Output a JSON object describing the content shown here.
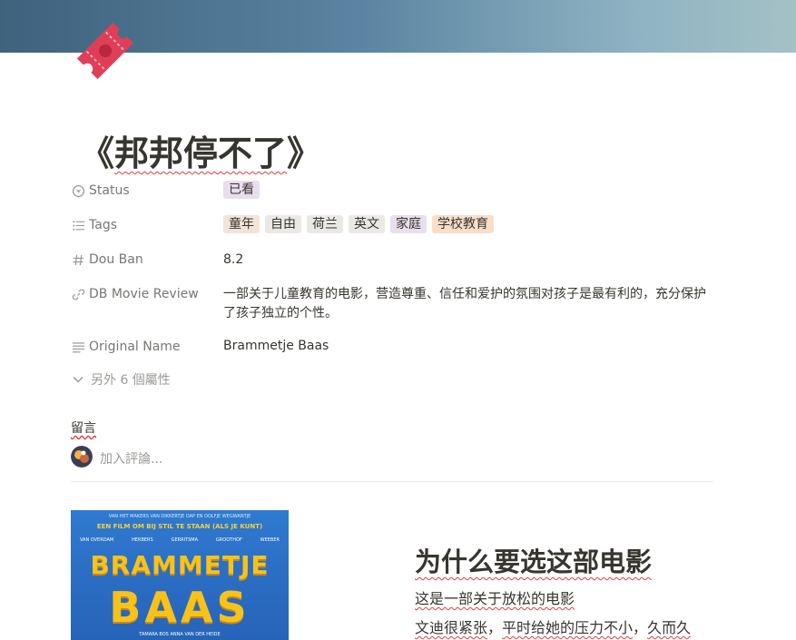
{
  "page": {
    "title_open": "《",
    "title_main": "邦邦停不了",
    "title_close": "》"
  },
  "colors": {
    "tag_purple": "#e8deee",
    "tag_brown": "#f4e3d8",
    "tag_gray": "#eae9e6",
    "tag_orange": "#fadec9",
    "icon_red": "#e03e57"
  },
  "properties": {
    "status": {
      "label": "Status",
      "icon": "status-icon",
      "value": "已看"
    },
    "tags": {
      "label": "Tags",
      "icon": "list-icon",
      "values": [
        "童年",
        "自由",
        "荷兰",
        "英文",
        "家庭",
        "学校教育"
      ]
    },
    "douban": {
      "label": "Dou Ban",
      "icon": "hash-icon",
      "value": "8.2"
    },
    "review": {
      "label": "DB Movie Review",
      "icon": "link-icon",
      "line1": "一部关于儿童教育的电影，营造尊重、信任和爱护的氛围对孩子是最有利的，充分保护",
      "line2": "了孩子独立的个性。"
    },
    "original_name": {
      "label": "Original Name",
      "icon": "text-icon",
      "value": "Brammetje Baas"
    },
    "more": "另外 6 個屬性"
  },
  "comments": {
    "label": "留言",
    "placeholder": "加入評論..."
  },
  "poster": {
    "top_small": "VAN HET MAKERS VAN DIKKERTJE DAP EN DOLFJE WEGWANTJE",
    "tagline": "EEN FILM OM BIJ STIL TE STAAN (ALS JE KUNT)",
    "cast": [
      "VAN OVERDAM",
      "HERBERS",
      "GERRITSMA",
      "GROOTHOF",
      "WEEBER"
    ],
    "title_line1": "BRAMMETJE",
    "title_line2": "BAAS",
    "credits": "TAMARA BOS  ANNA VAN DER HEIDE"
  },
  "section": {
    "heading": "为什么要选这部电影",
    "p1": "这是一部关于放松的电影",
    "p2a": "文迪很紧张",
    "p2b": "，",
    "p2c": "平时给她的压力不小",
    "p2d": "，",
    "p2e": "久而久"
  }
}
